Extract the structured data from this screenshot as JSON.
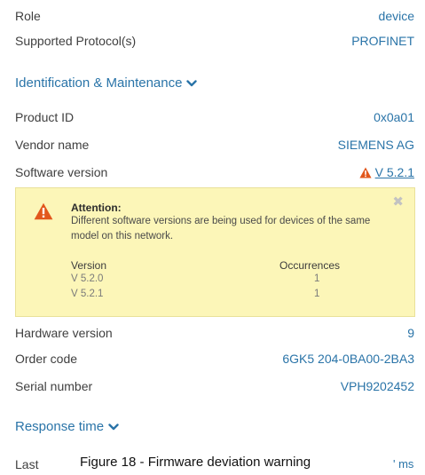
{
  "device": {
    "role_label": "Role",
    "role_value": "device",
    "protocol_label": "Supported Protocol(s)",
    "protocol_value": "PROFINET"
  },
  "identification": {
    "section_title": "Identification & Maintenance",
    "product_id_label": "Product ID",
    "product_id_value": "0x0a01",
    "vendor_label": "Vendor name",
    "vendor_value": "SIEMENS AG",
    "software_label": "Software version",
    "software_value": "V 5.2.1",
    "hardware_label": "Hardware version",
    "hardware_value": "9",
    "order_label": "Order code",
    "order_value": "6GK5 204-0BA00-2BA3",
    "serial_label": "Serial number",
    "serial_value": "VPH9202452"
  },
  "alert": {
    "title": "Attention:",
    "message": "Different software versions are being used for devices of the same model on this network.",
    "col_version": "Version",
    "col_occurrences": "Occurrences",
    "rows": [
      {
        "version": "V 5.2.0",
        "occurrences": "1"
      },
      {
        "version": "V 5.2.1",
        "occurrences": "1"
      }
    ],
    "close_glyph": "✖"
  },
  "response": {
    "section_title": "Response time",
    "last_label": "Last",
    "unit": "' ms"
  },
  "caption": "Figure 18 - Firmware deviation warning",
  "colors": {
    "link": "#2a74a8",
    "warning": "#e2571c",
    "alert_bg": "#fcf6b8"
  }
}
